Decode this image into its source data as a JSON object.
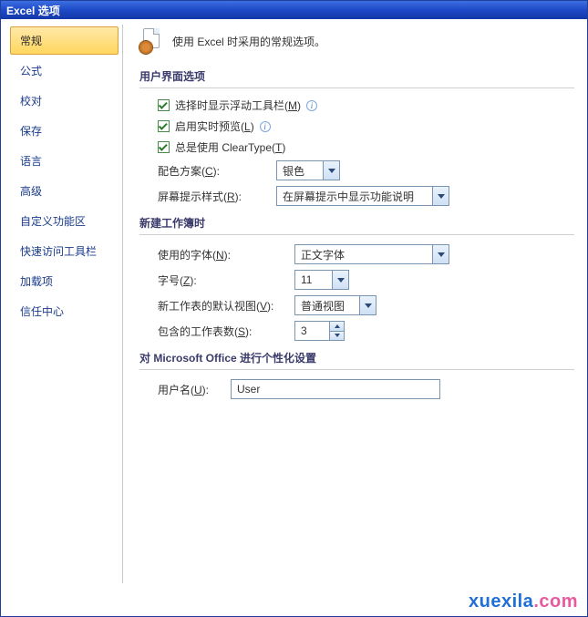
{
  "titlebar": "Excel 选项",
  "sidebar": {
    "items": [
      {
        "label": "常规",
        "active": true
      },
      {
        "label": "公式"
      },
      {
        "label": "校对"
      },
      {
        "label": "保存"
      },
      {
        "label": "语言"
      },
      {
        "label": "高级"
      },
      {
        "label": "自定义功能区"
      },
      {
        "label": "快速访问工具栏"
      },
      {
        "label": "加载项"
      },
      {
        "label": "信任中心"
      }
    ]
  },
  "intro": "使用 Excel 时采用的常规选项。",
  "section1": {
    "title": "用户界面选项",
    "check1": {
      "pre": "选择时显示浮动工具栏(",
      "key": "M",
      "post": ")"
    },
    "check2": {
      "pre": "启用实时预览(",
      "key": "L",
      "post": ")"
    },
    "check3": {
      "pre": "总是使用 ClearType(",
      "key": "T",
      "post": ")"
    },
    "color_label": {
      "pre": "配色方案(",
      "key": "C",
      "post": "):"
    },
    "color_value": "银色",
    "tip_label": {
      "pre": "屏幕提示样式(",
      "key": "R",
      "post": "):"
    },
    "tip_value": "在屏幕提示中显示功能说明"
  },
  "section2": {
    "title": "新建工作簿时",
    "font_label": {
      "pre": "使用的字体(",
      "key": "N",
      "post": "):"
    },
    "font_value": "正文字体",
    "size_label": {
      "pre": "字号(",
      "key": "Z",
      "post": "):"
    },
    "size_value": "11",
    "view_label": {
      "pre": "新工作表的默认视图(",
      "key": "V",
      "post": "):"
    },
    "view_value": "普通视图",
    "sheets_label": {
      "pre": "包含的工作表数(",
      "key": "S",
      "post": "):"
    },
    "sheets_value": "3"
  },
  "section3": {
    "title": "对 Microsoft Office 进行个性化设置",
    "user_label": {
      "pre": "用户名(",
      "key": "U",
      "post": "):"
    },
    "user_value": "User"
  },
  "watermark": {
    "a": "xuexila",
    "b": ".com"
  }
}
